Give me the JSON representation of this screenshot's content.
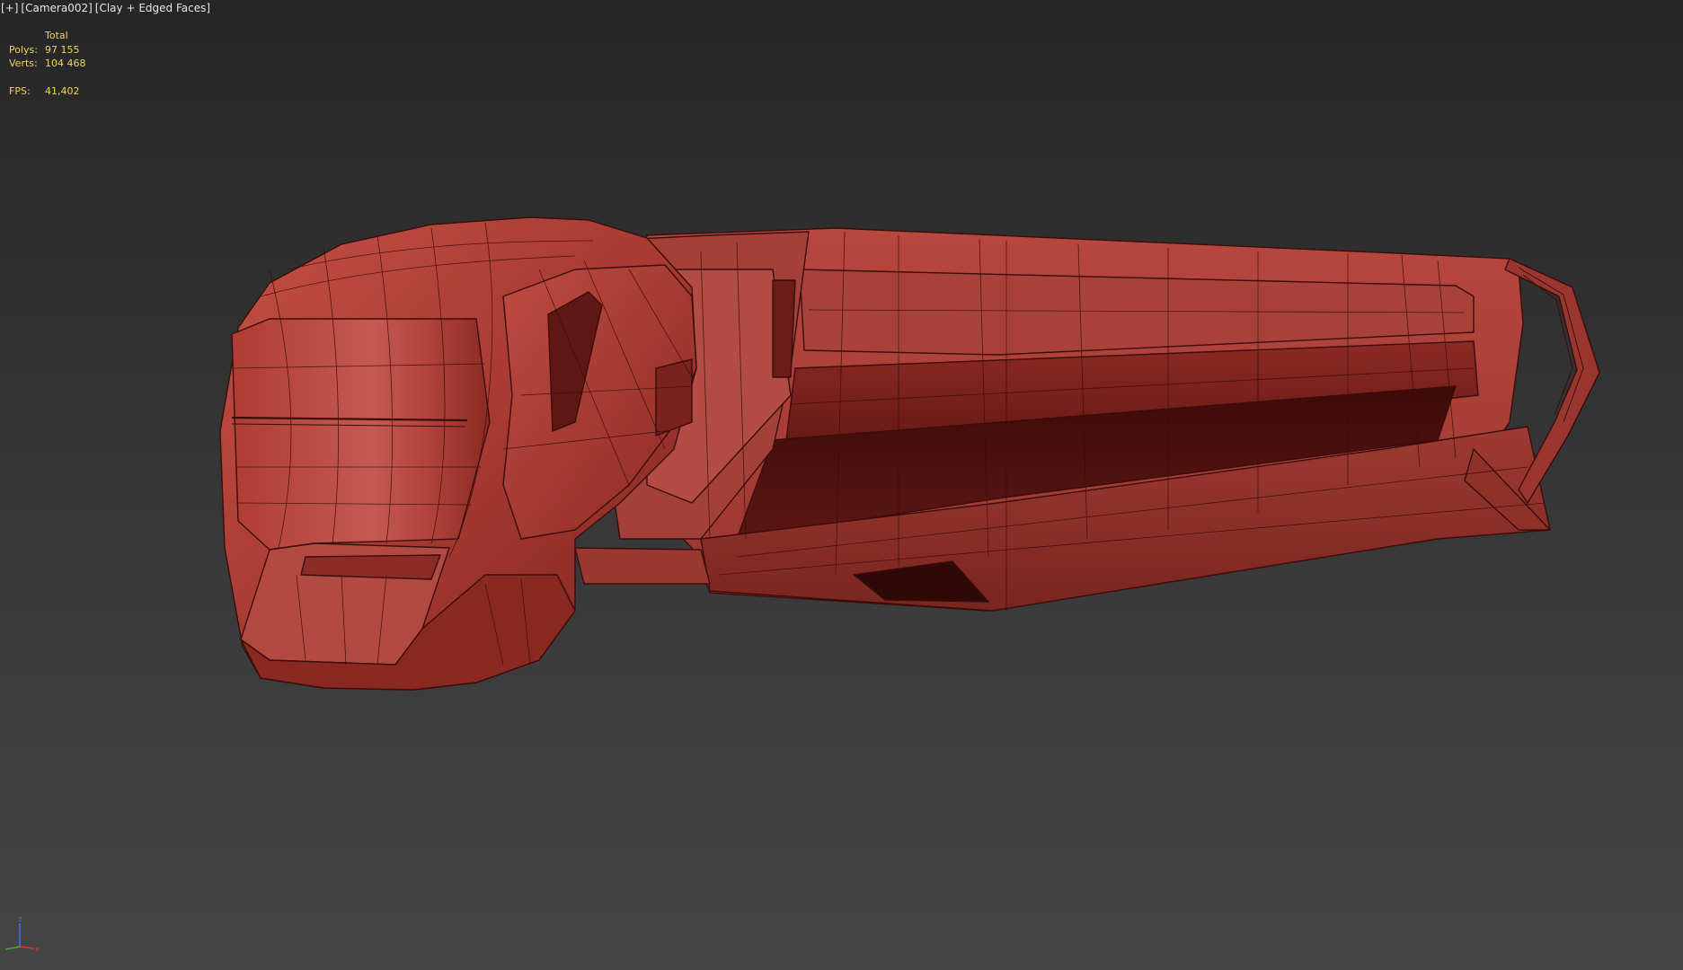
{
  "viewport": {
    "label": {
      "menu": "[+]",
      "camera": "[Camera002]",
      "shading": "[Clay + Edged Faces]"
    },
    "stats": {
      "header": "Total",
      "polys_label": "Polys:",
      "polys_value": "97 155",
      "verts_label": "Verts:",
      "verts_value": "104 468",
      "fps_label": "FPS:",
      "fps_value": "41,402"
    },
    "gizmo": {
      "z": "z",
      "x": "x",
      "icon": "axis-tripod-icon"
    }
  },
  "colors": {
    "stats_text": "#f2d35b",
    "clay": "#b5433a",
    "clay_dark": "#6e1a16",
    "wire": "#3a0d0a",
    "axis_x": "#d23a2a",
    "axis_y": "#3fae3a",
    "axis_z": "#4a6ee0"
  }
}
